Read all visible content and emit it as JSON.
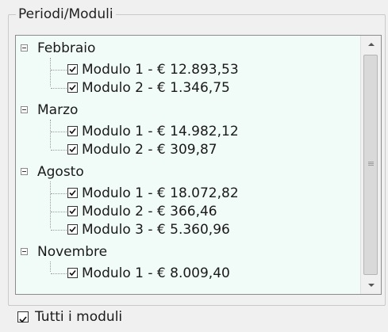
{
  "group": {
    "title": "Periodi/Moduli"
  },
  "tree": {
    "nodes": [
      {
        "label": "Febbraio",
        "children": [
          {
            "label": "Modulo 1 - € 12.893,53",
            "checked": true
          },
          {
            "label": "Modulo 2 - € 1.346,75",
            "checked": true
          }
        ]
      },
      {
        "label": "Marzo",
        "children": [
          {
            "label": "Modulo 1 - € 14.982,12",
            "checked": true
          },
          {
            "label": "Modulo 2 - € 309,87",
            "checked": true
          }
        ]
      },
      {
        "label": "Agosto",
        "children": [
          {
            "label": "Modulo 1 - € 18.072,82",
            "checked": true
          },
          {
            "label": "Modulo 2 - € 366,46",
            "checked": true
          },
          {
            "label": "Modulo 3 - € 5.360,96",
            "checked": true
          }
        ]
      },
      {
        "label": "Novembre",
        "children": [
          {
            "label": "Modulo 1 - € 8.009,40",
            "checked": true
          }
        ]
      }
    ]
  },
  "footer": {
    "all_modules_label": "Tutti i moduli",
    "all_modules_checked": true
  }
}
